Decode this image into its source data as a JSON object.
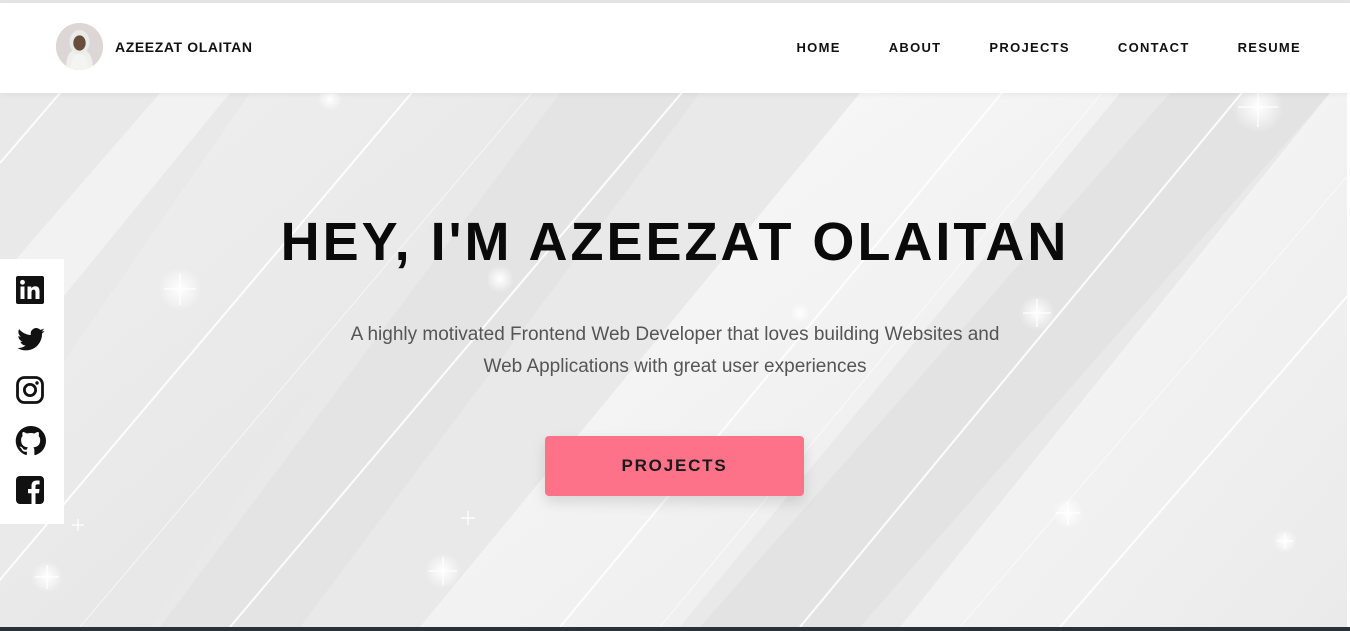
{
  "brand": {
    "name": "AZEEZAT OLAITAN"
  },
  "nav": {
    "items": [
      "HOME",
      "ABOUT",
      "PROJECTS",
      "CONTACT",
      "RESUME"
    ]
  },
  "hero": {
    "title": "HEY, I'M AZEEZAT OLAITAN",
    "subtitle_line1": "A highly motivated Frontend Web Developer that loves building Websites and",
    "subtitle_line2": "Web Applications with great user experiences",
    "cta_label": "PROJECTS"
  },
  "social": {
    "icons": [
      "linkedin-icon",
      "twitter-icon",
      "instagram-icon",
      "github-icon",
      "facebook-icon"
    ]
  },
  "colors": {
    "accent": "#fd7289",
    "text": "#0a0a0a",
    "subtext": "#555555",
    "bottom_bar": "#27323a"
  }
}
